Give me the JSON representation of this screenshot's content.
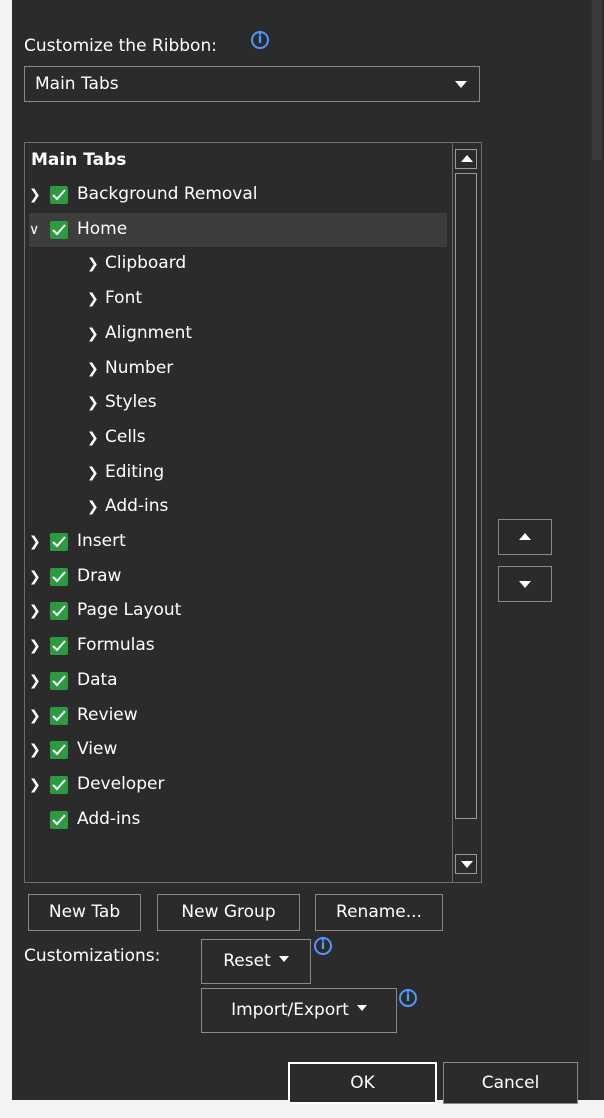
{
  "header": {
    "customize_label": "Customize the Ribbon:",
    "info_glyph": "i"
  },
  "dropdown": {
    "value": "Main Tabs"
  },
  "tree": {
    "header": "Main Tabs",
    "items": [
      {
        "label": "Background Removal",
        "level": 0,
        "expanded": false,
        "checked": true
      },
      {
        "label": "Home",
        "level": 0,
        "expanded": true,
        "checked": true,
        "selected": true
      },
      {
        "label": "Clipboard",
        "level": 1
      },
      {
        "label": "Font",
        "level": 1
      },
      {
        "label": "Alignment",
        "level": 1
      },
      {
        "label": "Number",
        "level": 1
      },
      {
        "label": "Styles",
        "level": 1
      },
      {
        "label": "Cells",
        "level": 1
      },
      {
        "label": "Editing",
        "level": 1
      },
      {
        "label": "Add-ins",
        "level": 1
      },
      {
        "label": "Insert",
        "level": 0,
        "expanded": false,
        "checked": true
      },
      {
        "label": "Draw",
        "level": 0,
        "expanded": false,
        "checked": true
      },
      {
        "label": "Page Layout",
        "level": 0,
        "expanded": false,
        "checked": true
      },
      {
        "label": "Formulas",
        "level": 0,
        "expanded": false,
        "checked": true
      },
      {
        "label": "Data",
        "level": 0,
        "expanded": false,
        "checked": true
      },
      {
        "label": "Review",
        "level": 0,
        "expanded": false,
        "checked": true
      },
      {
        "label": "View",
        "level": 0,
        "expanded": false,
        "checked": true
      },
      {
        "label": "Developer",
        "level": 0,
        "expanded": false,
        "checked": true
      },
      {
        "label": "Add-ins",
        "level": 0,
        "expanded": null,
        "checked": true
      }
    ]
  },
  "buttons": {
    "new_tab": "New Tab",
    "new_group": "New Group",
    "rename": "Rename...",
    "customizations_label": "Customizations:",
    "reset": "Reset",
    "import_export": "Import/Export",
    "ok": "OK",
    "cancel": "Cancel"
  },
  "colors": {
    "background": "#2b2b2b",
    "checkbox": "#2b9b3f",
    "info": "#4a9bff",
    "selected_row": "#3d3d3d"
  }
}
